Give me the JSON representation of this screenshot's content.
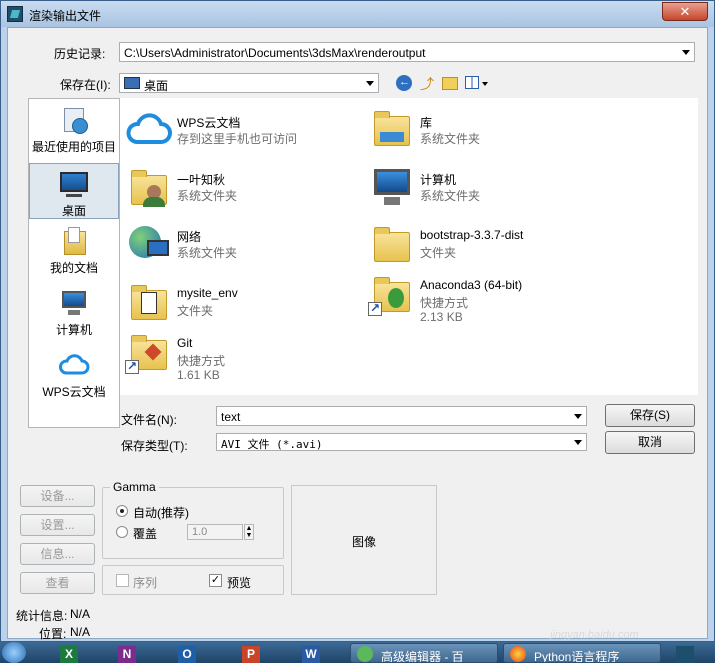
{
  "window": {
    "title": "渲染输出文件",
    "close_label": "✕"
  },
  "history": {
    "label": "历史记录:",
    "value": "C:\\Users\\Administrator\\Documents\\3dsMax\\renderoutput"
  },
  "save_in": {
    "label": "保存在(I):",
    "value": "桌面"
  },
  "places": [
    {
      "label": "最近使用的项目",
      "icon": "recent-icon"
    },
    {
      "label": "桌面",
      "icon": "desktop-icon"
    },
    {
      "label": "我的文档",
      "icon": "documents-icon"
    },
    {
      "label": "计算机",
      "icon": "computer-icon"
    },
    {
      "label": "WPS云文档",
      "icon": "cloud-icon"
    }
  ],
  "files": [
    {
      "name": "WPS云文档",
      "sub": "存到这里手机也可访问",
      "sub2": "",
      "icon": "cloud-icon"
    },
    {
      "name": "库",
      "sub": "系统文件夹",
      "sub2": "",
      "icon": "library-icon"
    },
    {
      "name": "一叶知秋",
      "sub": "系统文件夹",
      "sub2": "",
      "icon": "user-folder-icon"
    },
    {
      "name": "计算机",
      "sub": "系统文件夹",
      "sub2": "",
      "icon": "computer-icon"
    },
    {
      "name": "网络",
      "sub": "系统文件夹",
      "sub2": "",
      "icon": "network-icon"
    },
    {
      "name": "bootstrap-3.3.7-dist",
      "sub": "文件夹",
      "sub2": "",
      "icon": "folder-icon"
    },
    {
      "name": "mysite_env",
      "sub": "文件夹",
      "sub2": "",
      "icon": "folder-icon"
    },
    {
      "name": "Anaconda3 (64-bit)",
      "sub": "快捷方式",
      "sub2": "2.13 KB",
      "icon": "shortcut-folder-icon"
    },
    {
      "name": "Git",
      "sub": "快捷方式",
      "sub2": "1.61 KB",
      "icon": "shortcut-folder-icon"
    }
  ],
  "filename": {
    "label": "文件名(N):",
    "value": "text"
  },
  "filetype": {
    "label": "保存类型(T):",
    "value": "AVI 文件 (*.avi)"
  },
  "buttons": {
    "save": "保存(S)",
    "cancel": "取消",
    "setup": "设备...",
    "settings": "设置...",
    "info": "信息...",
    "view": "查看"
  },
  "gamma": {
    "title": "Gamma",
    "auto_label": "自动(推荐)",
    "override_label": "覆盖",
    "override_value": "1.0"
  },
  "sequence_label": "序列",
  "preview_label": "预览",
  "image_label": "图像",
  "stats": {
    "label": "统计信息:",
    "value": "N/A"
  },
  "location": {
    "label": "位置:",
    "value": "N/A"
  },
  "taskbar": {
    "apps": [
      {
        "letter": "X",
        "color": "#1d7a3e"
      },
      {
        "letter": "N",
        "color": "#7b2c8d"
      },
      {
        "letter": "O",
        "color": "#1f5fa8"
      },
      {
        "letter": "P",
        "color": "#c9452a"
      },
      {
        "letter": "W",
        "color": "#2b5aa4"
      }
    ],
    "tasks": [
      "高级编辑器 - 百",
      "Python语言程序"
    ],
    "watermark": "jingyan.baidu.com"
  }
}
